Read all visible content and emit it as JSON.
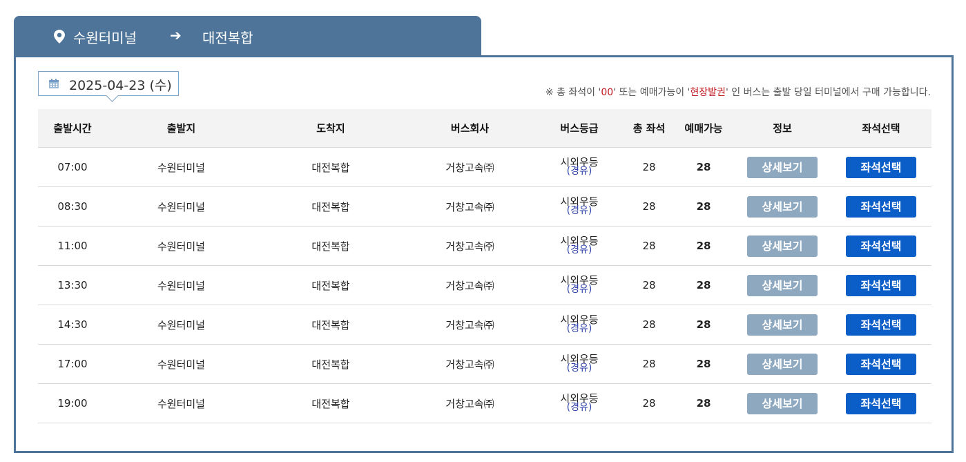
{
  "route": {
    "from": "수원터미널",
    "arrow": "➔",
    "to": "대전복합"
  },
  "date_label": "2025-04-23 (수)",
  "notice": {
    "prefix": "※ 총 좌석이 '",
    "zero": "00",
    "middle": "' 또는 예매가능이 '",
    "onsite": "현장발권",
    "suffix": "' 인 버스는 출발 당일 터미널에서 구매 가능합니다."
  },
  "table": {
    "headers": [
      "출발시간",
      "출발지",
      "도착지",
      "버스회사",
      "버스등급",
      "총 좌석",
      "예매가능",
      "정보",
      "좌석선택"
    ],
    "rows": [
      {
        "time": "07:00",
        "from": "수원터미널",
        "to": "대전복합",
        "company": "거창고속㈜",
        "grade": "시외우등",
        "grade_sub": "(경유)",
        "total": "28",
        "available": "28",
        "detail_label": "상세보기",
        "seat_label": "좌석선택"
      },
      {
        "time": "08:30",
        "from": "수원터미널",
        "to": "대전복합",
        "company": "거창고속㈜",
        "grade": "시외우등",
        "grade_sub": "(경유)",
        "total": "28",
        "available": "28",
        "detail_label": "상세보기",
        "seat_label": "좌석선택"
      },
      {
        "time": "11:00",
        "from": "수원터미널",
        "to": "대전복합",
        "company": "거창고속㈜",
        "grade": "시외우등",
        "grade_sub": "(경유)",
        "total": "28",
        "available": "28",
        "detail_label": "상세보기",
        "seat_label": "좌석선택"
      },
      {
        "time": "13:30",
        "from": "수원터미널",
        "to": "대전복합",
        "company": "거창고속㈜",
        "grade": "시외우등",
        "grade_sub": "(경유)",
        "total": "28",
        "available": "28",
        "detail_label": "상세보기",
        "seat_label": "좌석선택"
      },
      {
        "time": "14:30",
        "from": "수원터미널",
        "to": "대전복합",
        "company": "거창고속㈜",
        "grade": "시외우등",
        "grade_sub": "(경유)",
        "total": "28",
        "available": "28",
        "detail_label": "상세보기",
        "seat_label": "좌석선택"
      },
      {
        "time": "17:00",
        "from": "수원터미널",
        "to": "대전복합",
        "company": "거창고속㈜",
        "grade": "시외우등",
        "grade_sub": "(경유)",
        "total": "28",
        "available": "28",
        "detail_label": "상세보기",
        "seat_label": "좌석선택"
      },
      {
        "time": "19:00",
        "from": "수원터미널",
        "to": "대전복합",
        "company": "거창고속㈜",
        "grade": "시외우등",
        "grade_sub": "(경유)",
        "total": "28",
        "available": "28",
        "detail_label": "상세보기",
        "seat_label": "좌석선택"
      }
    ]
  },
  "colors": {
    "header_bar": "#4e7599",
    "detail_button": "#8ea8bf",
    "seat_button": "#0b5dc7",
    "notice_highlight": "#c0161e",
    "via_text": "#2b3fa8"
  },
  "icons": {
    "location": "map-pin-icon",
    "date": "calendar-icon"
  }
}
